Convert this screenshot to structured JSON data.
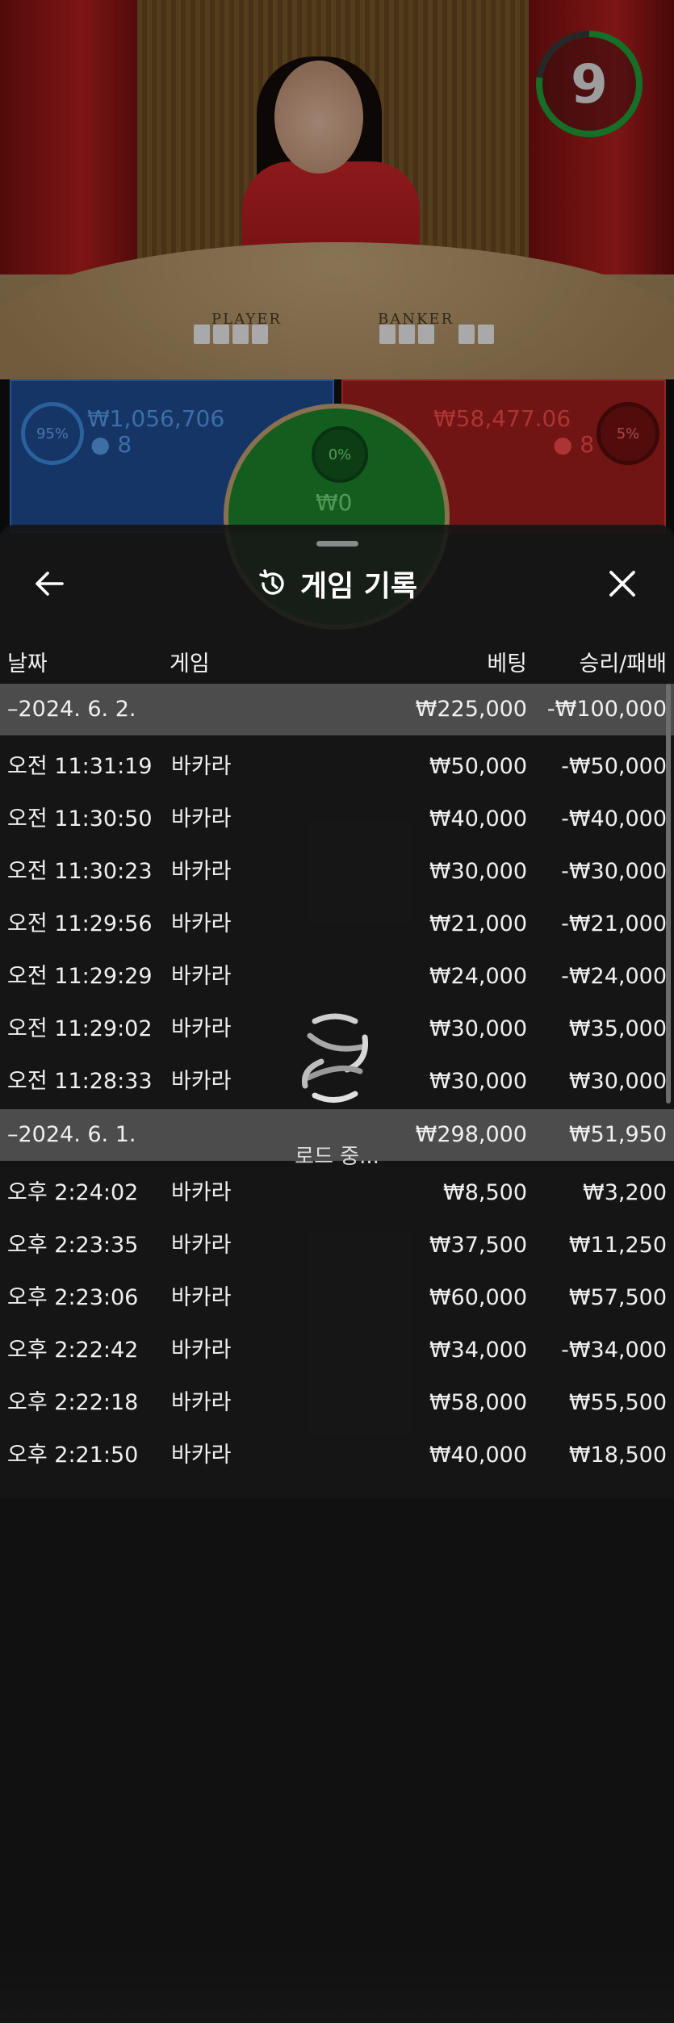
{
  "stream": {
    "timer_value": "9",
    "table_labels": {
      "player": "PLAYER",
      "banker": "BANKER"
    },
    "colors": {
      "player": "#1f4f97",
      "banker": "#a51e1e",
      "tie": "#1d8a2e",
      "timer_ring": "#22a33a"
    }
  },
  "bet_spots": {
    "player": {
      "percent": "95%",
      "amount": "₩1,056,706",
      "count": "8"
    },
    "tie": {
      "percent": "0%",
      "amount": "₩0"
    },
    "banker": {
      "percent": "5%",
      "amount": "₩58,477.06",
      "count": "8"
    }
  },
  "history": {
    "title": "게임 기록",
    "title_icon": "history-clock-icon",
    "back_icon": "arrow-left-icon",
    "close_icon": "close-icon",
    "columns": {
      "date": "날짜",
      "game": "게임",
      "bet": "베팅",
      "win_loss": "승리/패배"
    },
    "groups": [
      {
        "date": "–2024. 6. 2.",
        "bet_total": "₩225,000",
        "win_total": "-₩100,000",
        "rows": [
          {
            "time": "오전 11:31:19",
            "game": "바카라",
            "bet": "₩50,000",
            "result": "-₩50,000"
          },
          {
            "time": "오전 11:30:50",
            "game": "바카라",
            "bet": "₩40,000",
            "result": "-₩40,000"
          },
          {
            "time": "오전 11:30:23",
            "game": "바카라",
            "bet": "₩30,000",
            "result": "-₩30,000"
          },
          {
            "time": "오전 11:29:56",
            "game": "바카라",
            "bet": "₩21,000",
            "result": "-₩21,000"
          },
          {
            "time": "오전 11:29:29",
            "game": "바카라",
            "bet": "₩24,000",
            "result": "-₩24,000"
          },
          {
            "time": "오전 11:29:02",
            "game": "바카라",
            "bet": "₩30,000",
            "result": "₩35,000"
          },
          {
            "time": "오전 11:28:33",
            "game": "바카라",
            "bet": "₩30,000",
            "result": "₩30,000"
          }
        ]
      },
      {
        "date": "–2024. 6. 1.",
        "bet_total": "₩298,000",
        "win_total": "₩51,950",
        "rows": [
          {
            "time": "오후 2:24:02",
            "game": "바카라",
            "bet": "₩8,500",
            "result": "₩3,200"
          },
          {
            "time": "오후 2:23:35",
            "game": "바카라",
            "bet": "₩37,500",
            "result": "₩11,250"
          },
          {
            "time": "오후 2:23:06",
            "game": "바카라",
            "bet": "₩60,000",
            "result": "₩57,500"
          },
          {
            "time": "오후 2:22:42",
            "game": "바카라",
            "bet": "₩34,000",
            "result": "-₩34,000"
          },
          {
            "time": "오후 2:22:18",
            "game": "바카라",
            "bet": "₩58,000",
            "result": "₩55,500"
          },
          {
            "time": "오후 2:21:50",
            "game": "바카라",
            "bet": "₩40,000",
            "result": "₩18,500"
          }
        ]
      }
    ],
    "loading_text": "로드 중..."
  }
}
